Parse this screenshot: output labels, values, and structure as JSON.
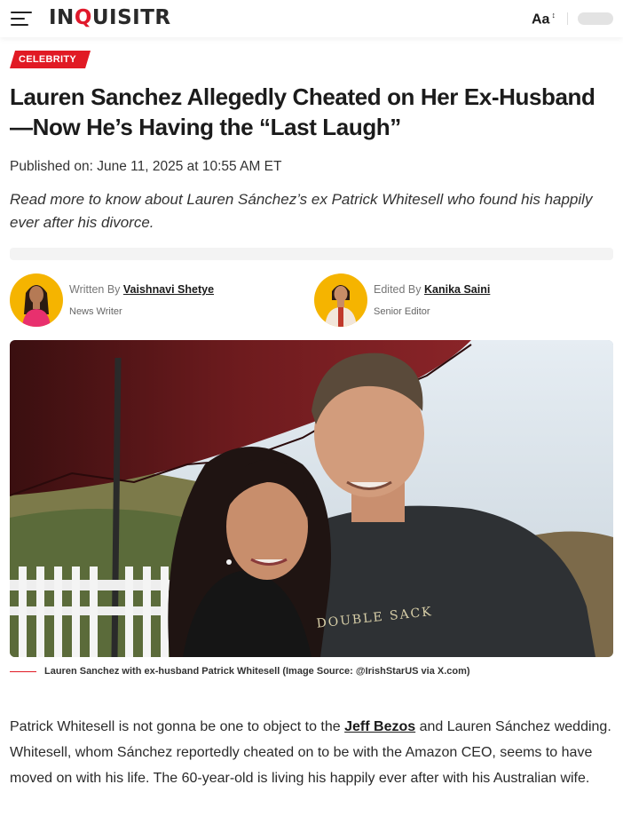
{
  "header": {
    "logo_part1": "IN",
    "logo_part2": "Q",
    "logo_part3": "UISITR",
    "font_size_label": "Aa",
    "font_size_arrow": "↕"
  },
  "article": {
    "category": "CELEBRITY",
    "title": "Lauren Sanchez Allegedly Cheated on Her Ex-Husband—Now He’s Having the “Last Laugh”",
    "published": "Published on: June 11, 2025 at 10:55 AM ET",
    "dek": "Read more to know about Lauren Sánchez’s ex Patrick Whitesell who found his happily ever after his divorce.",
    "writer": {
      "prefix": "Written By",
      "name": "Vaishnavi Shetye",
      "role": "News Writer"
    },
    "editor": {
      "prefix": "Edited By",
      "name": "Kanika Saini",
      "role": "Senior Editor"
    },
    "image_caption": "Lauren Sanchez with ex-husband Patrick Whitesell (Image Source: @IrishStarUS via X.com)",
    "shirt_text": "DOUBLE SACK",
    "body_text_1": "Patrick Whitesell is not gonna be one to object to the",
    "body_link": "Jeff Bezos",
    "body_text_2": "and Lauren Sánchez wedding. Whitesell, whom Sánchez reportedly cheated on to be with the Amazon CEO, seems to have moved on with his life. The 60-year-old is living his happily ever after with his Australian wife."
  },
  "colors": {
    "accent": "#e11a24",
    "avatar_bg": "#f5b400"
  }
}
